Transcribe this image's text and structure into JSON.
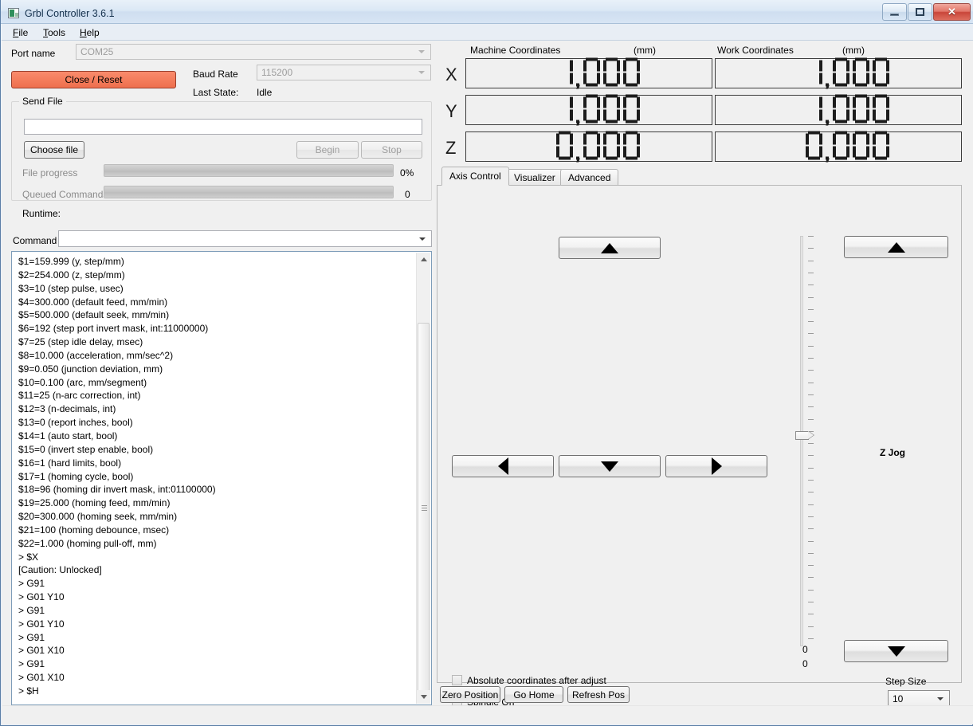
{
  "window": {
    "title": "Grbl Controller 3.6.1",
    "icon": "app-icon",
    "buttons": {
      "minimize": "minimize-icon",
      "maximize": "maximize-icon",
      "close": "✕"
    }
  },
  "menubar": {
    "items": [
      {
        "label": "File",
        "mnemonic": "F"
      },
      {
        "label": "Tools",
        "mnemonic": "T"
      },
      {
        "label": "Help",
        "mnemonic": "H"
      }
    ]
  },
  "connection": {
    "port_label": "Port name",
    "port_value": "COM25",
    "baud_label": "Baud Rate",
    "baud_value": "115200",
    "last_state_label": "Last State:",
    "last_state_value": "Idle",
    "close_reset_button": "Close / Reset",
    "close_reset_color": "#f4805f"
  },
  "send_file": {
    "group_title": "Send File",
    "file_path": "",
    "choose_file_button": "Choose file",
    "begin_button": "Begin",
    "stop_button": "Stop",
    "file_progress_label": "File progress",
    "file_progress_value": "0%",
    "file_progress_percent": 0,
    "queued_commands_label": "Queued Commands",
    "queued_commands_value": "0",
    "queued_commands_percent": 0,
    "runtime_label": "Runtime:"
  },
  "command": {
    "label": "Command",
    "value": ""
  },
  "console": {
    "lines": [
      "$1=159.999 (y, step/mm)",
      "$2=254.000 (z, step/mm)",
      "$3=10 (step pulse, usec)",
      "$4=300.000 (default feed, mm/min)",
      "$5=500.000 (default seek, mm/min)",
      "$6=192 (step port invert mask, int:11000000)",
      "$7=25 (step idle delay, msec)",
      "$8=10.000 (acceleration, mm/sec^2)",
      "$9=0.050 (junction deviation, mm)",
      "$10=0.100 (arc, mm/segment)",
      "$11=25 (n-arc correction, int)",
      "$12=3 (n-decimals, int)",
      "$13=0 (report inches, bool)",
      "$14=1 (auto start, bool)",
      "$15=0 (invert step enable, bool)",
      "$16=1 (hard limits, bool)",
      "$17=1 (homing cycle, bool)",
      "$18=96 (homing dir invert mask, int:01100000)",
      "$19=25.000 (homing feed, mm/min)",
      "$20=300.000 (homing seek, mm/min)",
      "$21=100 (homing debounce, msec)",
      "$22=1.000 (homing pull-off, mm)",
      "> $X",
      "[Caution: Unlocked]",
      "> G91",
      "> G01 Y10",
      "> G91",
      "> G01 Y10",
      "> G91",
      "> G01 X10",
      "> G91",
      "> G01 X10",
      "> $H"
    ]
  },
  "coordinates": {
    "machine_header": "Machine Coordinates",
    "machine_unit": "(mm)",
    "work_header": "Work Coordinates",
    "work_unit": "(mm)",
    "axes": [
      "X",
      "Y",
      "Z"
    ],
    "machine": [
      "1.000",
      "1.000",
      "0.000"
    ],
    "work": [
      "1.000",
      "1.000",
      "0.000"
    ]
  },
  "tabs": [
    {
      "label": "Axis Control",
      "active": true
    },
    {
      "label": "Visualizer",
      "active": false
    },
    {
      "label": "Advanced",
      "active": false
    }
  ],
  "axis_control": {
    "jog_up": "up-arrow-icon",
    "jog_down": "down-arrow-icon",
    "jog_left": "left-arrow-icon",
    "jog_right": "right-arrow-icon",
    "z_jog_label": "Z Jog",
    "z_up": "up-arrow-icon",
    "z_down": "down-arrow-icon",
    "slider_min_label": "0",
    "slider_value_label": "0",
    "absolute_checkbox_label": "Absolute coordinates after adjust",
    "absolute_checked": false,
    "spindle_checkbox_label": "Spindle On",
    "spindle_checked": false,
    "step_size_label": "Step Size",
    "step_size_value": "10"
  },
  "bottom_buttons": {
    "zero_position": "Zero Position",
    "go_home": "Go Home",
    "refresh_pos": "Refresh Pos"
  }
}
